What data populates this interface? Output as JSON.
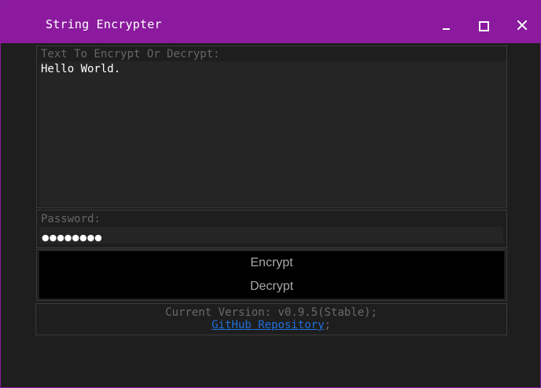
{
  "window": {
    "title": "String Encrypter",
    "titlebar_color": "#8b1a9e",
    "background_color": "#1e1e1e"
  },
  "text_field": {
    "label": "Text To Encrypt Or Decrypt:",
    "value": "Hello World."
  },
  "password_field": {
    "label": "Password:",
    "masked_value": "●●●●●●●●"
  },
  "buttons": {
    "encrypt_label": "Encrypt",
    "decrypt_label": "Decrypt"
  },
  "footer": {
    "version_text": "Current Version: v0.9.5(Stable);",
    "link_label": "GitHub Repository",
    "link_suffix": ";",
    "link_color": "#1e6fd9"
  },
  "icons": [
    "minimize-icon",
    "maximize-icon",
    "close-icon"
  ]
}
